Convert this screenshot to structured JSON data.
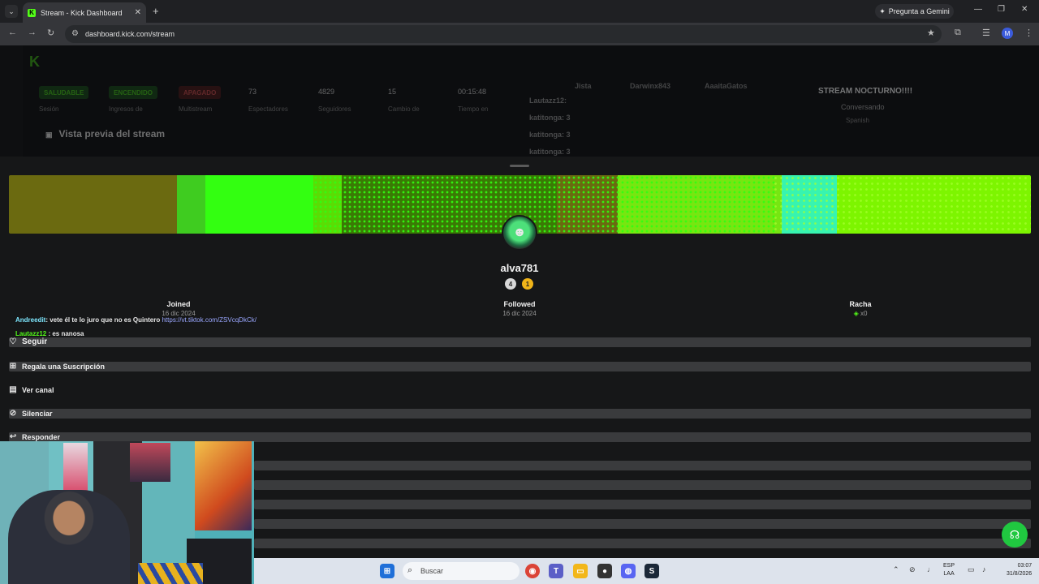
{
  "browser": {
    "tab_title": "Stream - Kick Dashboard",
    "tab_favicon": "K",
    "gemini_label": "Pregunta a Gemini",
    "url": "dashboard.kick.com/stream",
    "profile_initial": "M"
  },
  "dashboard": {
    "status_pills": [
      {
        "label": "SALUDABLE",
        "sub": "Sesión",
        "color": "#1a7a1a"
      },
      {
        "label": "ENCENDIDO",
        "sub": "Ingresos de",
        "color": "#1a7a1a"
      },
      {
        "label": "APAGADO",
        "sub": "Multistream",
        "color": "#7a1a1a"
      }
    ],
    "stats": [
      {
        "value": "73",
        "label": "Espectadores"
      },
      {
        "value": "4829",
        "label": "Seguidores"
      },
      {
        "value": "15",
        "label": "Cambio de"
      },
      {
        "value": "00:15:48",
        "label": "Tiempo en"
      }
    ],
    "preview_title": "Vista previa del stream",
    "top_users": [
      "Jista",
      "Darwinx843",
      "AaaitaGatos"
    ],
    "chat_lines": [
      "Lautazz12:",
      "katitonga: 3",
      "katitonga: 3",
      "katitonga: 3"
    ],
    "stream_title": "STREAM NOCTURNO!!!!",
    "category": "Conversando",
    "language": "Spanish"
  },
  "profile": {
    "username": "alva781",
    "badge1": "4",
    "badge2": "1",
    "joined_label": "Joined",
    "joined_date": "16 dic 2024",
    "followed_label": "Followed",
    "followed_date": "16 dic 2024",
    "streak_label": "Racha",
    "streak_value": "x0"
  },
  "chat_overlay": [
    {
      "user": "Andreedit",
      "text": ": vete él te lo juro que no es Quintero ",
      "link": "https://vt.tiktok.com/ZSVcqDkCk/"
    },
    {
      "user": "Lautazz12",
      "text": " : es nanosa",
      "link": ""
    }
  ],
  "actions": {
    "follow": "Seguir",
    "gift_sub": "Regala una Suscripción",
    "view_channel": "Ver canal",
    "mute": "Silenciar",
    "reply": "Responder"
  },
  "taskbar": {
    "search_placeholder": "Buscar",
    "lang_top": "ESP",
    "lang_bottom": "LAA",
    "time": "03:07",
    "date": "31/8/2026"
  }
}
